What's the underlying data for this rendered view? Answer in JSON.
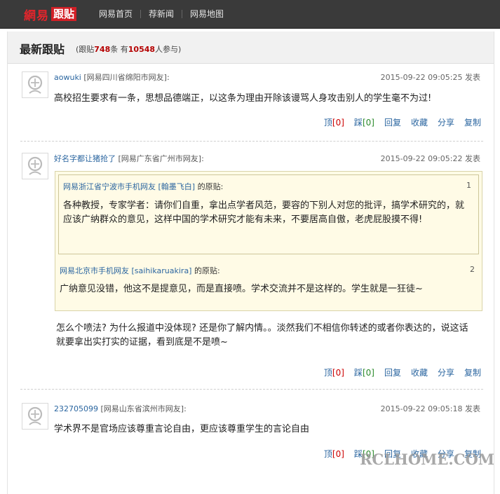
{
  "header": {
    "brand": "網易",
    "product": "跟贴",
    "nav": [
      "网易首页",
      "荐新闻",
      "网易地图"
    ]
  },
  "panel": {
    "title": "最新跟贴",
    "stats_prefix": "(跟贴",
    "post_count": "748",
    "stats_mid": "条  有",
    "user_count": "10548",
    "stats_suffix": "人参与)"
  },
  "posts": [
    {
      "user": "aowuki",
      "location": "[网易四川省绵阳市网友]:",
      "time": "2015-09-22 09:05:25 发表",
      "text": "高校招生要求有一条，思想品德端正，以这条为理由开除该谩骂人身攻击别人的学生毫不为过!"
    },
    {
      "user": "好名字都让猪抢了",
      "location": "[网易广东省广州市网友]:",
      "time": "2015-09-22 09:05:22 发表",
      "quotes": [
        {
          "author": "网易浙江省宁波市手机网友 [翰墨飞白]",
          "suffix": "的原贴:",
          "num": "1",
          "text": "各种教授，专家学者：请你们自重，拿出点学者风范，要容的下别人对您的批评，搞学术研究的，就应该广纳群众的意见，这样中国的学术研究才能有未来，不要居高自傲，老虎屁股摸不得!"
        },
        {
          "author": "网易北京市手机网友 [saihikaruakira]",
          "suffix": "的原贴:",
          "num": "2",
          "text": "广纳意见没错，他这不是提意见，而是直接喷。学术交流并不是这样的。学生就是一狂徒~"
        }
      ],
      "text": "怎么个喷法? 为什么报道中没体现? 还是你了解内情。。淡然我们不相信你转述的或者你表达的，说这话就要拿出实打实的证据，看到底是不是喷~"
    },
    {
      "user": "232705099",
      "location": "[网易山东省滨州市网友]:",
      "time": "2015-09-22 09:05:18 发表",
      "text": "学术界不是官场应该尊重言论自由，更应该尊重学生的言论自由"
    }
  ],
  "actions": {
    "up": "顶",
    "up_count": "[0]",
    "down": "踩",
    "down_count": "[0]",
    "reply": "回复",
    "fav": "收藏",
    "share": "分享",
    "copy": "复制"
  },
  "watermark": "RCLHOME.COM",
  "icons": {
    "avatar": "default-avatar-icon"
  }
}
